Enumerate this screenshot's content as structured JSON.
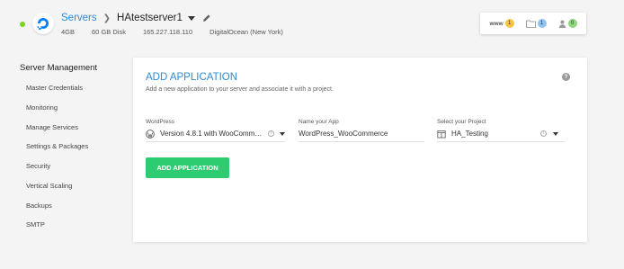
{
  "header": {
    "breadcrumb_root": "Servers",
    "server_name": "HAtestserver1",
    "ram": "4GB",
    "disk": "60 GB Disk",
    "ip": "165.227.118.110",
    "provider": "DigitalOcean (New York)",
    "status_color": "#7ed321",
    "counters": {
      "www_label": "www",
      "www_count": "1",
      "folder_count": "1",
      "users_count": "0"
    }
  },
  "sidebar": {
    "title": "Server Management",
    "items": [
      {
        "label": "Master Credentials"
      },
      {
        "label": "Monitoring"
      },
      {
        "label": "Manage Services"
      },
      {
        "label": "Settings & Packages"
      },
      {
        "label": "Security"
      },
      {
        "label": "Vertical Scaling"
      },
      {
        "label": "Backups"
      },
      {
        "label": "SMTP"
      }
    ]
  },
  "main": {
    "title": "ADD APPLICATION",
    "subtitle": "Add a new application to your server and associate it with a project.",
    "fields": {
      "app_type": {
        "label": "WordPress",
        "value": "Version 4.8.1 with WooCommerce"
      },
      "app_name": {
        "label": "Name your App",
        "value": "WordPress_WooCommerce"
      },
      "project": {
        "label": "Select your Project",
        "value": "HA_Testing"
      }
    },
    "add_button": "ADD APPLICATION",
    "accent_color": "#2f8bd6",
    "button_color": "#2ecc71"
  }
}
